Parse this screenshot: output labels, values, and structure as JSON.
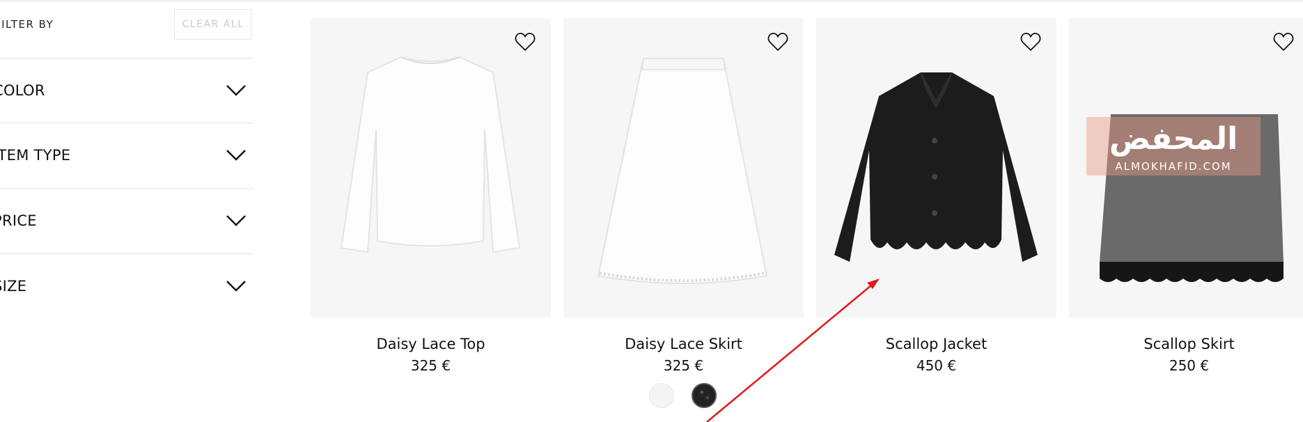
{
  "sidebar": {
    "filter_by": "FILTER BY",
    "clear_all": "CLEAR ALL",
    "facets": [
      {
        "label": "COLOR"
      },
      {
        "label": "ITEM TYPE"
      },
      {
        "label": "PRICE"
      },
      {
        "label": "SIZE"
      }
    ]
  },
  "products": [
    {
      "name": "Daisy Lace Top",
      "price": "325 €"
    },
    {
      "name": "Daisy Lace Skirt",
      "price": "325 €",
      "swatches": [
        "white",
        "black"
      ]
    },
    {
      "name": "Scallop Jacket",
      "price": "450 €"
    },
    {
      "name": "Scallop Skirt",
      "price": "250 €"
    }
  ],
  "watermark": {
    "text": "المحفض",
    "sub": "ALMOKHAFID.COM"
  },
  "colors": {
    "annotation_arrow": "#e5161b",
    "card_bg": "#f6f6f6"
  }
}
